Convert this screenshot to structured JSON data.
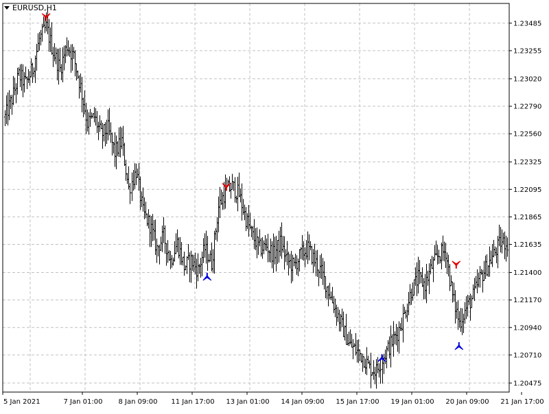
{
  "chart_data": {
    "type": "ohlc",
    "symbol": "EURUSD,H1",
    "ylim": [
      1.204,
      1.2365
    ],
    "y_ticks": [
      "1.23485",
      "1.23255",
      "1.23020",
      "1.22790",
      "1.22560",
      "1.22325",
      "1.22095",
      "1.21865",
      "1.21635",
      "1.21400",
      "1.21170",
      "1.20940",
      "1.20710",
      "1.20475"
    ],
    "x_ticks": [
      "5 Jan 2021",
      "7 Jan 01:00",
      "8 Jan 09:00",
      "11 Jan 17:00",
      "13 Jan 01:00",
      "14 Jan 09:00",
      "15 Jan 17:00",
      "19 Jan 01:00",
      "20 Jan 09:00",
      "21 Jan 17:00"
    ],
    "grid": true,
    "bar_color": "#000000",
    "grid_color": "#c0c0c0",
    "anchors": [
      [
        0,
        1.227
      ],
      [
        5,
        1.2285
      ],
      [
        10,
        1.2305
      ],
      [
        15,
        1.2298
      ],
      [
        20,
        1.231
      ],
      [
        25,
        1.2335
      ],
      [
        30,
        1.2345
      ],
      [
        35,
        1.2325
      ],
      [
        40,
        1.231
      ],
      [
        45,
        1.233
      ],
      [
        50,
        1.232
      ],
      [
        55,
        1.2295
      ],
      [
        60,
        1.2265
      ],
      [
        65,
        1.227
      ],
      [
        70,
        1.2255
      ],
      [
        75,
        1.226
      ],
      [
        80,
        1.224
      ],
      [
        85,
        1.225
      ],
      [
        90,
        1.221
      ],
      [
        95,
        1.2225
      ],
      [
        100,
        1.219
      ],
      [
        105,
        1.218
      ],
      [
        110,
        1.216
      ],
      [
        115,
        1.217
      ],
      [
        120,
        1.215
      ],
      [
        125,
        1.2165
      ],
      [
        130,
        1.2145
      ],
      [
        135,
        1.215
      ],
      [
        140,
        1.2142
      ],
      [
        145,
        1.216
      ],
      [
        150,
        1.2148
      ],
      [
        155,
        1.2195
      ],
      [
        160,
        1.2208
      ],
      [
        165,
        1.2212
      ],
      [
        170,
        1.2205
      ],
      [
        175,
        1.2185
      ],
      [
        180,
        1.217
      ],
      [
        185,
        1.216
      ],
      [
        190,
        1.2162
      ],
      [
        195,
        1.2155
      ],
      [
        200,
        1.2165
      ],
      [
        205,
        1.215
      ],
      [
        210,
        1.2145
      ],
      [
        215,
        1.2155
      ],
      [
        220,
        1.216
      ],
      [
        225,
        1.215
      ],
      [
        230,
        1.214
      ],
      [
        235,
        1.2125
      ],
      [
        240,
        1.211
      ],
      [
        245,
        1.2095
      ],
      [
        250,
        1.208
      ],
      [
        255,
        1.2075
      ],
      [
        260,
        1.207
      ],
      [
        265,
        1.206
      ],
      [
        270,
        1.2058
      ],
      [
        275,
        1.207
      ],
      [
        280,
        1.208
      ],
      [
        285,
        1.209
      ],
      [
        290,
        1.2105
      ],
      [
        295,
        1.2125
      ],
      [
        300,
        1.2135
      ],
      [
        305,
        1.213
      ],
      [
        310,
        1.2145
      ],
      [
        315,
        1.2155
      ],
      [
        320,
        1.2158
      ],
      [
        325,
        1.212
      ],
      [
        330,
        1.2098
      ],
      [
        335,
        1.211
      ],
      [
        340,
        1.212
      ],
      [
        345,
        1.2135
      ],
      [
        350,
        1.2145
      ],
      [
        355,
        1.2155
      ],
      [
        360,
        1.2165
      ],
      [
        365,
        1.2165
      ]
    ],
    "markers": [
      {
        "type": "top",
        "index": 30,
        "price": 1.2352
      },
      {
        "type": "top",
        "index": 161,
        "price": 1.221
      },
      {
        "type": "top",
        "index": 328,
        "price": 1.2145
      },
      {
        "type": "bottom",
        "index": 147,
        "price": 1.2138
      },
      {
        "type": "bottom",
        "index": 274,
        "price": 1.207
      },
      {
        "type": "bottom",
        "index": 330,
        "price": 1.208
      }
    ]
  }
}
